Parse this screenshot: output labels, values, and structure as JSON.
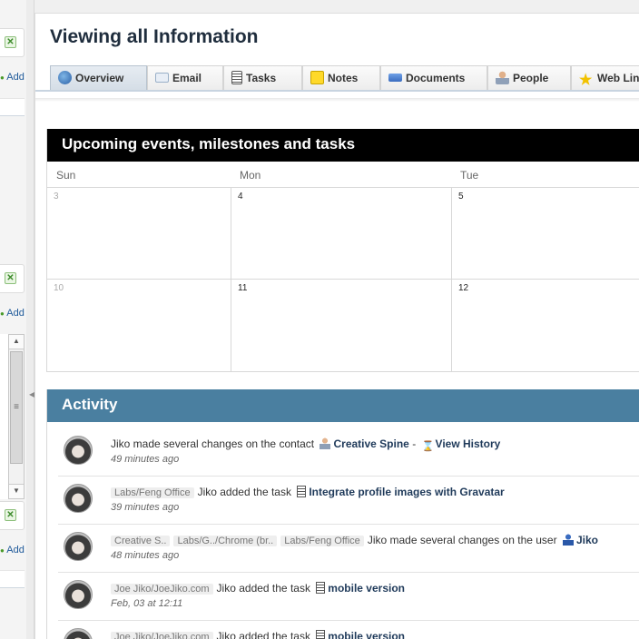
{
  "left_panel": {
    "add_label": "Add",
    "close_glyph": "✕",
    "scroll_up": "▲",
    "scroll_down": "▼",
    "scroll_grip": "≡"
  },
  "page": {
    "title": "Viewing all Information"
  },
  "tabs": [
    {
      "label": "Overview",
      "icon": "globe-icon",
      "active": true
    },
    {
      "label": "Email",
      "icon": "envelope-icon"
    },
    {
      "label": "Tasks",
      "icon": "task-list-icon"
    },
    {
      "label": "Notes",
      "icon": "note-icon"
    },
    {
      "label": "Documents",
      "icon": "documents-icon"
    },
    {
      "label": "People",
      "icon": "person-icon"
    },
    {
      "label": "Web Lin",
      "icon": "star-icon"
    }
  ],
  "calendar": {
    "title": "Upcoming events, milestones and tasks",
    "day_headers": [
      "Sun",
      "Mon",
      "Tue"
    ],
    "weeks": [
      [
        "3",
        "4",
        "5"
      ],
      [
        "10",
        "11",
        "12"
      ]
    ]
  },
  "activity": {
    "title": "Activity",
    "items": [
      {
        "tags": [],
        "text": "Jiko made several changes on the contact",
        "link": "Creative Spine",
        "separator": "-",
        "extra_link": "View History",
        "time": "49 minutes ago"
      },
      {
        "tags": [
          "Labs/Feng Office"
        ],
        "text": "Jiko added the task",
        "link": "Integrate profile images with Gravatar",
        "time": "39 minutes ago"
      },
      {
        "tags": [
          "Creative S..",
          "Labs/G../Chrome (br..",
          "Labs/Feng Office"
        ],
        "text": "Jiko made several changes on the user",
        "link": "Jiko",
        "time": "48 minutes ago"
      },
      {
        "tags": [
          "Joe Jiko/JoeJiko.com"
        ],
        "text": "Jiko added the task",
        "link": "mobile version",
        "time": "Feb, 03 at 12:11"
      },
      {
        "tags": [
          "Joe Jiko/JoeJiko.com"
        ],
        "text": "Jiko added the task",
        "link": "mobile version",
        "time": ""
      }
    ]
  },
  "colors": {
    "calendar_header": "#000000",
    "activity_header": "#4a7fa0",
    "link": "#1f3a5a"
  }
}
